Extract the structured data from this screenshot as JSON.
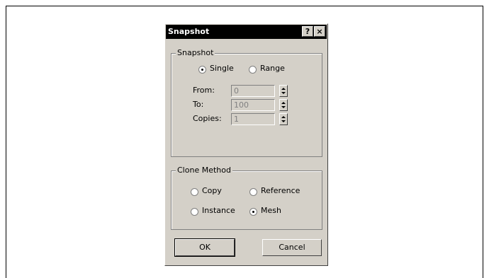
{
  "dialog": {
    "title": "Snapshot",
    "help_button": "?",
    "close_button": "×"
  },
  "snapshot_group": {
    "legend": "Snapshot",
    "mode": {
      "single_label": "Single",
      "range_label": "Range",
      "selected": "Single"
    },
    "from": {
      "label": "From:",
      "value": "0"
    },
    "to": {
      "label": "To:",
      "value": "100"
    },
    "copies": {
      "label": "Copies:",
      "value": "1"
    }
  },
  "clone_group": {
    "legend": "Clone Method",
    "copy_label": "Copy",
    "reference_label": "Reference",
    "instance_label": "Instance",
    "mesh_label": "Mesh",
    "selected": "Mesh"
  },
  "buttons": {
    "ok_label": "OK",
    "cancel_label": "Cancel"
  }
}
